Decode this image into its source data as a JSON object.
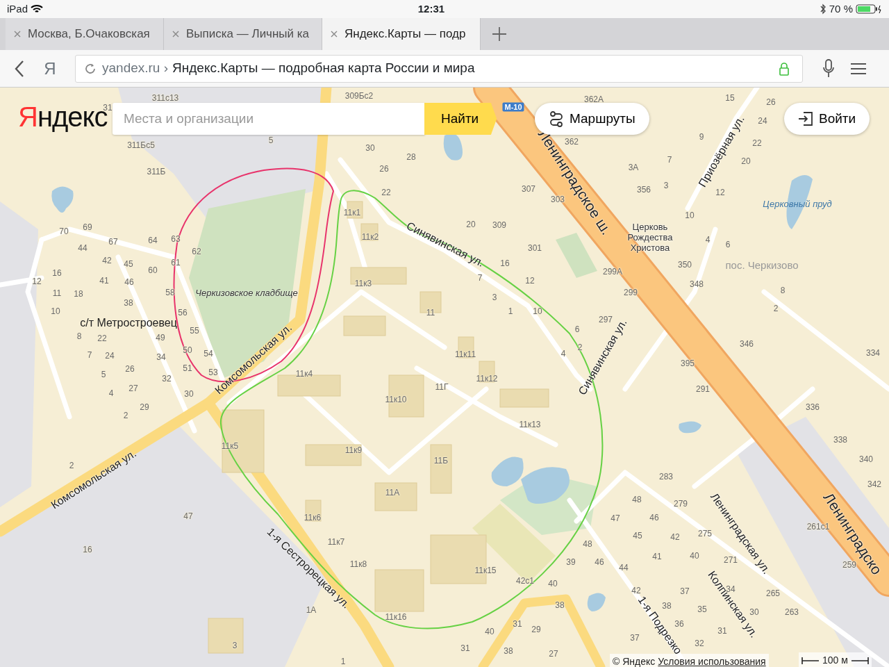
{
  "status_bar": {
    "device": "iPad",
    "time": "12:31",
    "battery": "70 %"
  },
  "tabs": [
    {
      "title": "Москва, Б.Очаковская",
      "selected": false
    },
    {
      "title": "Выписка — Личный ка",
      "selected": false
    },
    {
      "title": "Яндекс.Карты — подр",
      "selected": true
    }
  ],
  "address_bar": {
    "yandex_button": "Я",
    "domain": "yandex.ru ›",
    "page_title": "Яндекс.Карты — подробная карта России и мира"
  },
  "map_header": {
    "logo": "Яндекс",
    "search": {
      "placeholder": "Места и организации"
    },
    "search_button": "Найти",
    "routes_button": "Маршруты",
    "login_button": "Войти"
  },
  "map": {
    "labels": [
      {
        "text": "Ленинградское ш.",
        "kind": "highway"
      },
      {
        "text": "Ленинградско",
        "kind": "highway"
      },
      {
        "text": "Синявинская ул.",
        "kind": "street"
      },
      {
        "text": "Синявинская ул.",
        "kind": "street"
      },
      {
        "text": "Приозёрная ул.",
        "kind": "street"
      },
      {
        "text": "Комсомольская ул.",
        "kind": "street"
      },
      {
        "text": "Комсомольская ул.",
        "kind": "street"
      },
      {
        "text": "1-я Сестрорецкая ул.",
        "kind": "street"
      },
      {
        "text": "Ленинградская ул.",
        "kind": "street"
      },
      {
        "text": "Колпинская ул.",
        "kind": "street"
      },
      {
        "text": "1-я Подрезко",
        "kind": "street"
      },
      {
        "text": "Черкизовское кладбище",
        "kind": "cemetery"
      },
      {
        "text": "с/т Метростроевец",
        "kind": "district"
      },
      {
        "text": "пос. Черкизово",
        "kind": "settlement"
      },
      {
        "text": "Церковный пруд",
        "kind": "water"
      },
      {
        "text": "Церковь Рождества Христова",
        "kind": "poi"
      },
      {
        "text": "М-10",
        "kind": "shield"
      },
      {
        "text": "311с13",
        "kind": "house"
      },
      {
        "text": "309Бс2",
        "kind": "house"
      },
      {
        "text": "31",
        "kind": "house"
      },
      {
        "text": "5",
        "kind": "house"
      },
      {
        "text": "311Бс5",
        "kind": "house"
      },
      {
        "text": "311Б",
        "kind": "house"
      },
      {
        "text": "30",
        "kind": "house"
      },
      {
        "text": "28",
        "kind": "house"
      },
      {
        "text": "26",
        "kind": "house"
      },
      {
        "text": "22",
        "kind": "house"
      },
      {
        "text": "11к1",
        "kind": "house"
      },
      {
        "text": "11к2",
        "kind": "house"
      },
      {
        "text": "20",
        "kind": "house"
      },
      {
        "text": "309",
        "kind": "house"
      },
      {
        "text": "307",
        "kind": "house"
      },
      {
        "text": "303",
        "kind": "house"
      },
      {
        "text": "362",
        "kind": "house"
      },
      {
        "text": "362А",
        "kind": "house"
      },
      {
        "text": "3А",
        "kind": "house"
      },
      {
        "text": "356",
        "kind": "house"
      },
      {
        "text": "7",
        "kind": "house"
      },
      {
        "text": "3",
        "kind": "house"
      },
      {
        "text": "9",
        "kind": "house"
      },
      {
        "text": "15",
        "kind": "house"
      },
      {
        "text": "26",
        "kind": "house"
      },
      {
        "text": "24",
        "kind": "house"
      },
      {
        "text": "22",
        "kind": "house"
      },
      {
        "text": "20",
        "kind": "house"
      },
      {
        "text": "12",
        "kind": "house"
      },
      {
        "text": "10",
        "kind": "house"
      },
      {
        "text": "4",
        "kind": "house"
      },
      {
        "text": "6",
        "kind": "house"
      },
      {
        "text": "301",
        "kind": "house"
      },
      {
        "text": "16",
        "kind": "house"
      },
      {
        "text": "12",
        "kind": "house"
      },
      {
        "text": "299А",
        "kind": "house"
      },
      {
        "text": "299",
        "kind": "house"
      },
      {
        "text": "7",
        "kind": "house"
      },
      {
        "text": "3",
        "kind": "house"
      },
      {
        "text": "1",
        "kind": "house"
      },
      {
        "text": "10",
        "kind": "house"
      },
      {
        "text": "297",
        "kind": "house"
      },
      {
        "text": "6",
        "kind": "house"
      },
      {
        "text": "2",
        "kind": "house"
      },
      {
        "text": "4",
        "kind": "house"
      },
      {
        "text": "350",
        "kind": "house"
      },
      {
        "text": "348",
        "kind": "house"
      },
      {
        "text": "8",
        "kind": "house"
      },
      {
        "text": "2",
        "kind": "house"
      },
      {
        "text": "346",
        "kind": "house"
      },
      {
        "text": "395",
        "kind": "house"
      },
      {
        "text": "334",
        "kind": "house"
      },
      {
        "text": "291",
        "kind": "house"
      },
      {
        "text": "336",
        "kind": "house"
      },
      {
        "text": "338",
        "kind": "house"
      },
      {
        "text": "340",
        "kind": "house"
      },
      {
        "text": "342",
        "kind": "house"
      },
      {
        "text": "261с1",
        "kind": "house"
      },
      {
        "text": "259",
        "kind": "house"
      },
      {
        "text": "283",
        "kind": "house"
      },
      {
        "text": "279",
        "kind": "house"
      },
      {
        "text": "275",
        "kind": "house"
      },
      {
        "text": "271",
        "kind": "house"
      },
      {
        "text": "265",
        "kind": "house"
      },
      {
        "text": "263",
        "kind": "house"
      },
      {
        "text": "48",
        "kind": "house"
      },
      {
        "text": "46",
        "kind": "house"
      },
      {
        "text": "42",
        "kind": "house"
      },
      {
        "text": "40",
        "kind": "house"
      },
      {
        "text": "47",
        "kind": "house"
      },
      {
        "text": "45",
        "kind": "house"
      },
      {
        "text": "41",
        "kind": "house"
      },
      {
        "text": "44",
        "kind": "house"
      },
      {
        "text": "42",
        "kind": "house"
      },
      {
        "text": "48",
        "kind": "house"
      },
      {
        "text": "39",
        "kind": "house"
      },
      {
        "text": "46",
        "kind": "house"
      },
      {
        "text": "42с1",
        "kind": "house"
      },
      {
        "text": "40",
        "kind": "house"
      },
      {
        "text": "38",
        "kind": "house"
      },
      {
        "text": "37",
        "kind": "house"
      },
      {
        "text": "35",
        "kind": "house"
      },
      {
        "text": "34",
        "kind": "house"
      },
      {
        "text": "30",
        "kind": "house"
      },
      {
        "text": "38",
        "kind": "house"
      },
      {
        "text": "36",
        "kind": "house"
      },
      {
        "text": "31",
        "kind": "house"
      },
      {
        "text": "32",
        "kind": "house"
      },
      {
        "text": "37",
        "kind": "house"
      },
      {
        "text": "40",
        "kind": "house"
      },
      {
        "text": "31",
        "kind": "house"
      },
      {
        "text": "29",
        "kind": "house"
      },
      {
        "text": "38",
        "kind": "house"
      },
      {
        "text": "27",
        "kind": "house"
      },
      {
        "text": "31",
        "kind": "house"
      },
      {
        "text": "70",
        "kind": "house"
      },
      {
        "text": "69",
        "kind": "house"
      },
      {
        "text": "67",
        "kind": "house"
      },
      {
        "text": "64",
        "kind": "house"
      },
      {
        "text": "63",
        "kind": "house"
      },
      {
        "text": "62",
        "kind": "house"
      },
      {
        "text": "44",
        "kind": "house"
      },
      {
        "text": "42",
        "kind": "house"
      },
      {
        "text": "45",
        "kind": "house"
      },
      {
        "text": "16",
        "kind": "house"
      },
      {
        "text": "41",
        "kind": "house"
      },
      {
        "text": "46",
        "kind": "house"
      },
      {
        "text": "60",
        "kind": "house"
      },
      {
        "text": "61",
        "kind": "house"
      },
      {
        "text": "12",
        "kind": "house"
      },
      {
        "text": "11",
        "kind": "house"
      },
      {
        "text": "18",
        "kind": "house"
      },
      {
        "text": "38",
        "kind": "house"
      },
      {
        "text": "58",
        "kind": "house"
      },
      {
        "text": "10",
        "kind": "house"
      },
      {
        "text": "56",
        "kind": "house"
      },
      {
        "text": "8",
        "kind": "house"
      },
      {
        "text": "22",
        "kind": "house"
      },
      {
        "text": "49",
        "kind": "house"
      },
      {
        "text": "55",
        "kind": "house"
      },
      {
        "text": "7",
        "kind": "house"
      },
      {
        "text": "24",
        "kind": "house"
      },
      {
        "text": "34",
        "kind": "house"
      },
      {
        "text": "50",
        "kind": "house"
      },
      {
        "text": "54",
        "kind": "house"
      },
      {
        "text": "5",
        "kind": "house"
      },
      {
        "text": "26",
        "kind": "house"
      },
      {
        "text": "32",
        "kind": "house"
      },
      {
        "text": "51",
        "kind": "house"
      },
      {
        "text": "53",
        "kind": "house"
      },
      {
        "text": "27",
        "kind": "house"
      },
      {
        "text": "4",
        "kind": "house"
      },
      {
        "text": "30",
        "kind": "house"
      },
      {
        "text": "29",
        "kind": "house"
      },
      {
        "text": "2",
        "kind": "house"
      },
      {
        "text": "2",
        "kind": "house"
      },
      {
        "text": "47",
        "kind": "house"
      },
      {
        "text": "16",
        "kind": "house"
      },
      {
        "text": "11к3",
        "kind": "house"
      },
      {
        "text": "11",
        "kind": "house"
      },
      {
        "text": "11к4",
        "kind": "house"
      },
      {
        "text": "11к11",
        "kind": "house"
      },
      {
        "text": "11к12",
        "kind": "house"
      },
      {
        "text": "11Г",
        "kind": "house"
      },
      {
        "text": "11к10",
        "kind": "house"
      },
      {
        "text": "11к13",
        "kind": "house"
      },
      {
        "text": "11к5",
        "kind": "house"
      },
      {
        "text": "11к9",
        "kind": "house"
      },
      {
        "text": "11Б",
        "kind": "house"
      },
      {
        "text": "11А",
        "kind": "house"
      },
      {
        "text": "11к6",
        "kind": "house"
      },
      {
        "text": "11к7",
        "kind": "house"
      },
      {
        "text": "11к8",
        "kind": "house"
      },
      {
        "text": "11к15",
        "kind": "house"
      },
      {
        "text": "11к16",
        "kind": "house"
      },
      {
        "text": "1А",
        "kind": "house"
      },
      {
        "text": "3",
        "kind": "house"
      },
      {
        "text": "1",
        "kind": "house"
      }
    ]
  },
  "footer": {
    "copyright": "© Яндекс",
    "terms_link": "Условия использования",
    "scale": "100 м"
  }
}
